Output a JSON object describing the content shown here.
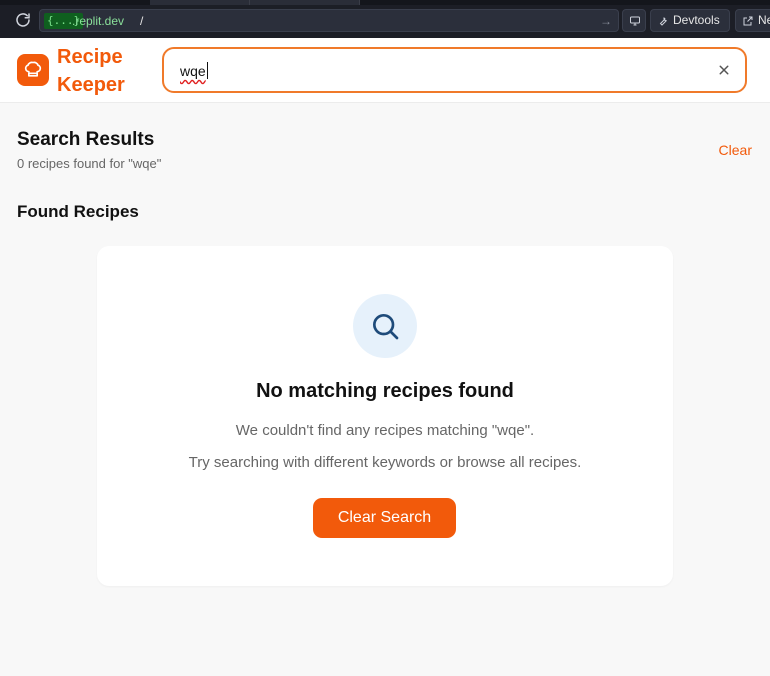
{
  "browser": {
    "url_badge": "{...}",
    "url_domain": ".replit.dev",
    "url_path": "/",
    "url_go": "→",
    "devtools_label": "Devtools",
    "newtab_label": "Ne"
  },
  "header": {
    "brand_line1": "Recipe",
    "brand_line2": "Keeper",
    "brand_color": "#f25a0b",
    "search_value": "wqe"
  },
  "results": {
    "title": "Search Results",
    "subtitle": "0 recipes found for \"wqe\"",
    "clear_label": "Clear",
    "section_title": "Found Recipes"
  },
  "empty_state": {
    "icon": "search-icon",
    "title": "No matching recipes found",
    "line1": "We couldn't find any recipes matching \"wqe\".",
    "line2": "Try searching with different keywords or browse all recipes.",
    "button_label": "Clear Search"
  }
}
